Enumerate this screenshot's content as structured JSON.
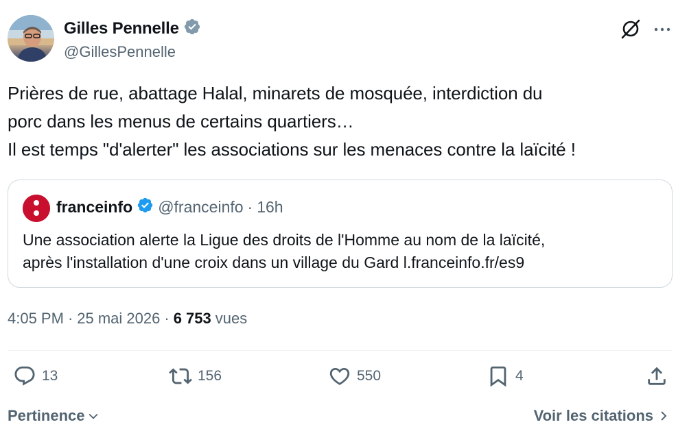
{
  "author": {
    "name": "Gilles Pennelle",
    "handle": "@GillesPennelle",
    "verified": true
  },
  "tweet": {
    "text": "Prières de rue, abattage Halal, minarets de mosquée, interdiction du\nporc dans les menus de certains quartiers…\nIl est temps \"d'alerter\" les associations sur les menaces contre la laïcité !"
  },
  "quote": {
    "name": "franceinfo",
    "handle": "@franceinfo",
    "separator": "·",
    "time": "16h",
    "text": "Une association alerte la Ligue des droits de l'Homme au nom de la laïcité,\naprès l'installation d'une croix dans un village du Gard l.franceinfo.fr/es9",
    "logo_color": "#c8102e"
  },
  "meta": {
    "time": "4:05 PM",
    "sep1": "·",
    "date": "25 mai 2026",
    "sep2": "·",
    "views_count": "6 753",
    "views_label": "vues"
  },
  "actions": {
    "replies": "13",
    "retweets": "156",
    "likes": "550",
    "bookmarks": "4"
  },
  "footer": {
    "sort_label": "Pertinence",
    "quotes_label": "Voir les citations"
  },
  "colors": {
    "text": "#0f1419",
    "secondary": "#536471",
    "verified": "#1d9bf0",
    "border": "#cfd9de"
  }
}
